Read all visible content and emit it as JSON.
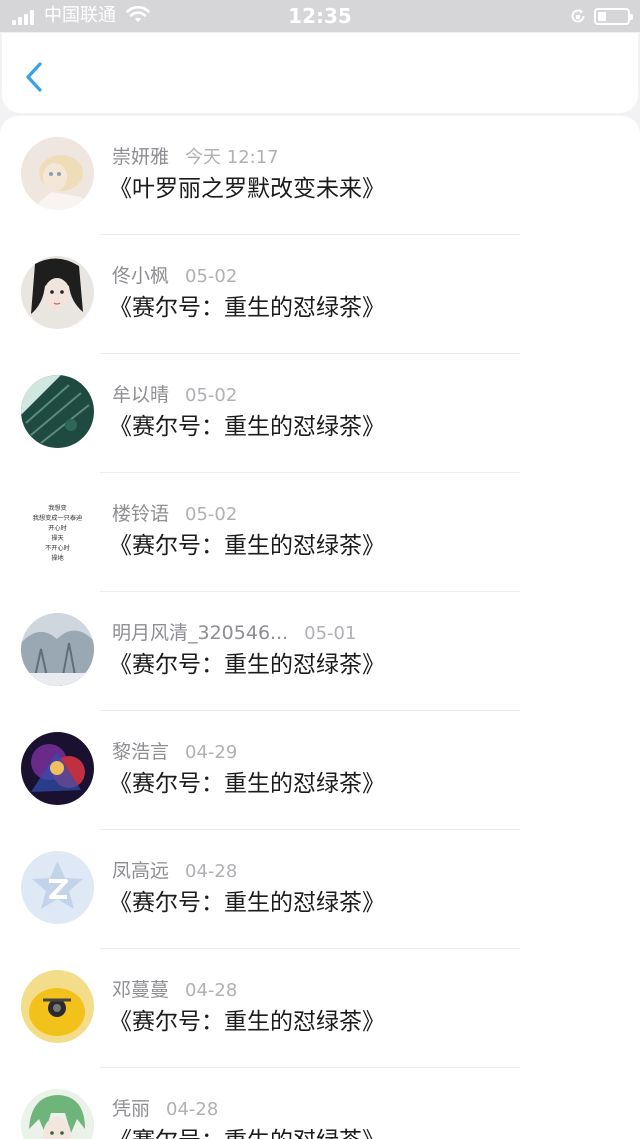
{
  "status_bar": {
    "carrier": "中国联通",
    "time": "12:35"
  },
  "header": {
    "back_icon": "chevron-left-icon",
    "accent_color": "#3aa0e8"
  },
  "comments": [
    {
      "name": "崇妍雅",
      "date": "今天 12:17",
      "title": "《叶罗丽之罗默改变未来》",
      "avatar": "blonde-doll-avatar"
    },
    {
      "name": "佟小枫",
      "date": "05-02",
      "title": "《赛尔号：重生的怼绿茶》",
      "avatar": "anime-girl-avatar"
    },
    {
      "name": "牟以晴",
      "date": "05-02",
      "title": "《赛尔号：重生的怼绿茶》",
      "avatar": "green-texture-avatar"
    },
    {
      "name": "楼铃语",
      "date": "05-02",
      "title": "《赛尔号：重生的怼绿茶》",
      "avatar": "text-avatar",
      "avatar_text": [
        "我想变",
        "我想变成一只泰迪",
        "开心时",
        "操天",
        "不开心时",
        "操地"
      ]
    },
    {
      "name": "明月风清_320546...",
      "date": "05-01",
      "title": "《赛尔号：重生的怼绿茶》",
      "avatar": "snow-trees-avatar"
    },
    {
      "name": "黎浩言",
      "date": "04-29",
      "title": "《赛尔号：重生的怼绿茶》",
      "avatar": "game-art-avatar"
    },
    {
      "name": "凤高远",
      "date": "04-28",
      "title": "《赛尔号：重生的怼绿茶》",
      "avatar": "default-z-avatar"
    },
    {
      "name": "邓蔓蔓",
      "date": "04-28",
      "title": "《赛尔号：重生的怼绿茶》",
      "avatar": "yellow-chick-avatar"
    },
    {
      "name": "凭丽",
      "date": "04-28",
      "title": "《赛尔号：重生的怼绿茶》",
      "avatar": "green-hair-anime-avatar"
    }
  ]
}
